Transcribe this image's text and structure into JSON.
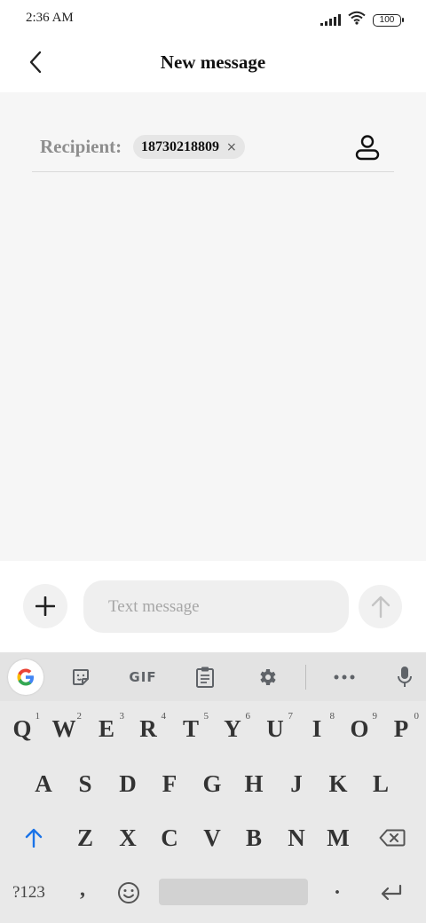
{
  "status_bar": {
    "time": "2:36 AM",
    "battery": "100",
    "icons": [
      "signal-icon",
      "wifi-icon",
      "battery-icon"
    ]
  },
  "header": {
    "title": "New message",
    "back_icon": "chevron-left-icon"
  },
  "recipient": {
    "label": "Recipient:",
    "chip_number": "18730218809",
    "chip_remove": "×",
    "contact_icon": "person-icon"
  },
  "compose": {
    "add_icon": "plus-icon",
    "placeholder": "Text message",
    "send_icon": "arrow-up-icon"
  },
  "keyboard": {
    "toolbar": {
      "gif_label": "GIF",
      "icons": [
        "google-icon",
        "sticker-icon",
        "gif-icon",
        "clipboard-icon",
        "settings-icon",
        "more-icon",
        "mic-icon"
      ]
    },
    "row1": [
      {
        "label": "Q",
        "hint": "1"
      },
      {
        "label": "W",
        "hint": "2"
      },
      {
        "label": "E",
        "hint": "3"
      },
      {
        "label": "R",
        "hint": "4"
      },
      {
        "label": "T",
        "hint": "5"
      },
      {
        "label": "Y",
        "hint": "6"
      },
      {
        "label": "U",
        "hint": "7"
      },
      {
        "label": "I",
        "hint": "8"
      },
      {
        "label": "O",
        "hint": "9"
      },
      {
        "label": "P",
        "hint": "0"
      }
    ],
    "row2": [
      "A",
      "S",
      "D",
      "F",
      "G",
      "H",
      "J",
      "K",
      "L"
    ],
    "row3": [
      "Z",
      "X",
      "C",
      "V",
      "B",
      "N",
      "M"
    ],
    "symbols_label": "?123",
    "comma": ",",
    "period": ".",
    "accent_color": "#1a73e8"
  }
}
